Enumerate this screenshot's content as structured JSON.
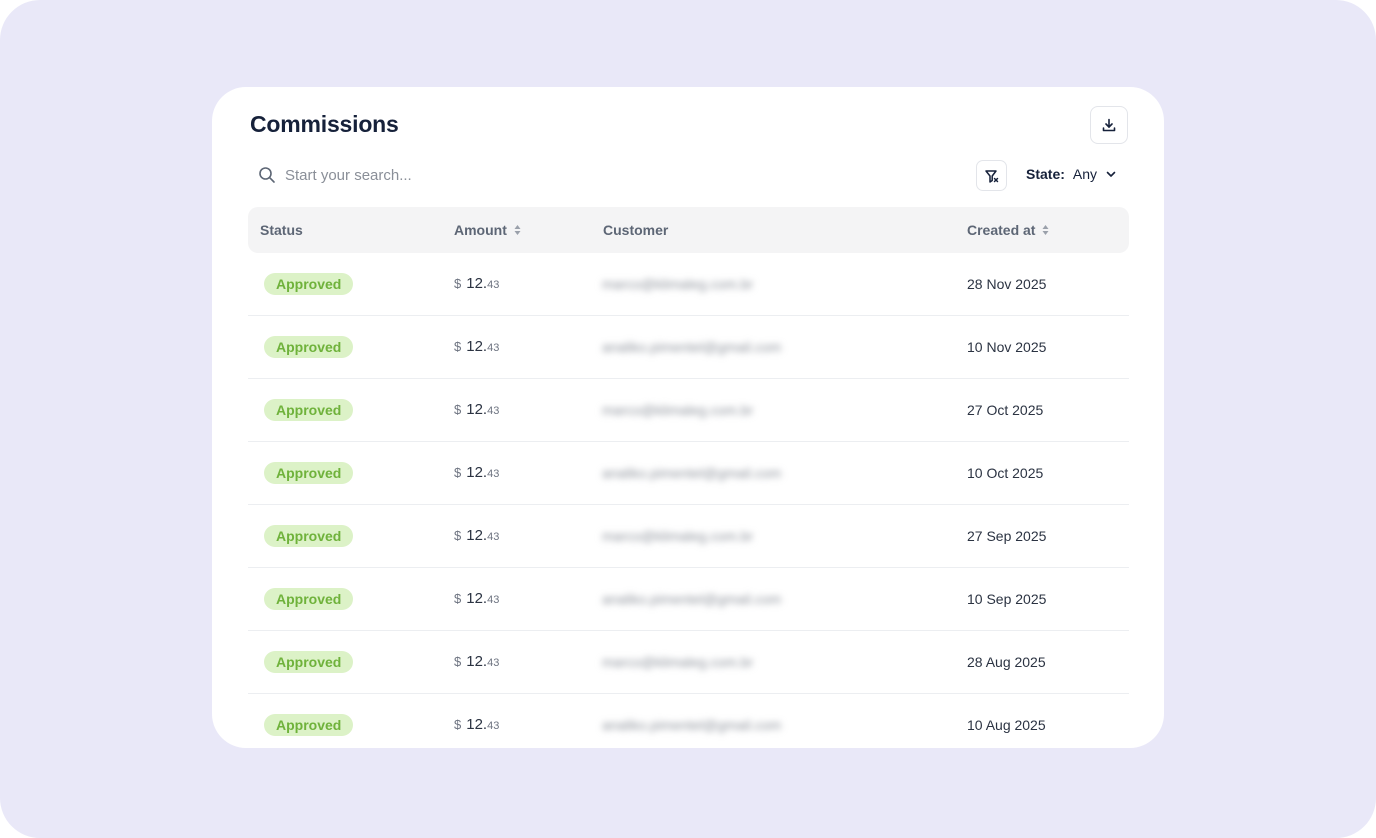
{
  "header": {
    "title": "Commissions",
    "export_icon": "download-icon"
  },
  "search": {
    "placeholder": "Start your search...",
    "value": "",
    "icon": "search-icon"
  },
  "filters": {
    "filter_icon": "filter-clear-icon",
    "state_label": "State:",
    "state_value": "Any",
    "dropdown_icon": "chevron-down-icon"
  },
  "table": {
    "columns": {
      "status": "Status",
      "amount": "Amount",
      "customer": "Customer",
      "created_at": "Created at"
    },
    "rows": [
      {
        "status": "Approved",
        "currency": "$",
        "amount_int": "12.",
        "amount_dec": "43",
        "customer": "marco@klimaleg.com.br",
        "created_at": "28 Nov 2025"
      },
      {
        "status": "Approved",
        "currency": "$",
        "amount_int": "12.",
        "amount_dec": "43",
        "customer": "analiko.pimentel@gmail.com",
        "created_at": "10 Nov 2025"
      },
      {
        "status": "Approved",
        "currency": "$",
        "amount_int": "12.",
        "amount_dec": "43",
        "customer": "marco@klimaleg.com.br",
        "created_at": "27 Oct 2025"
      },
      {
        "status": "Approved",
        "currency": "$",
        "amount_int": "12.",
        "amount_dec": "43",
        "customer": "analiko.pimentel@gmail.com",
        "created_at": "10 Oct 2025"
      },
      {
        "status": "Approved",
        "currency": "$",
        "amount_int": "12.",
        "amount_dec": "43",
        "customer": "marco@klimaleg.com.br",
        "created_at": "27 Sep 2025"
      },
      {
        "status": "Approved",
        "currency": "$",
        "amount_int": "12.",
        "amount_dec": "43",
        "customer": "analiko.pimentel@gmail.com",
        "created_at": "10 Sep 2025"
      },
      {
        "status": "Approved",
        "currency": "$",
        "amount_int": "12.",
        "amount_dec": "43",
        "customer": "marco@klimaleg.com.br",
        "created_at": "28 Aug 2025"
      },
      {
        "status": "Approved",
        "currency": "$",
        "amount_int": "12.",
        "amount_dec": "43",
        "customer": "analiko.pimentel@gmail.com",
        "created_at": "10 Aug 2025"
      }
    ]
  },
  "colors": {
    "backdrop": "#e9e8f8",
    "approved_bg": "#dcf2c7",
    "approved_text": "#6fb23b",
    "title": "#16213a"
  }
}
